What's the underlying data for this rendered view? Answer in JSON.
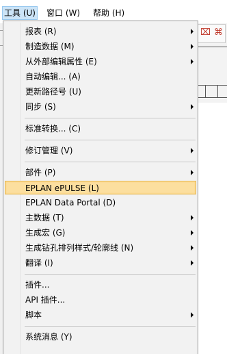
{
  "menubar": {
    "items": [
      {
        "label": "工具 (U)"
      },
      {
        "label": "窗口 (W)"
      },
      {
        "label": "帮助 (H)"
      }
    ]
  },
  "background": {
    "toolbar_glyphs": [
      "⌧",
      "⌘"
    ]
  },
  "menu": {
    "items": [
      {
        "label": "报表 (R)",
        "submenu": true
      },
      {
        "label": "制造数据 (M)",
        "submenu": true
      },
      {
        "label": "从外部编辑属性 (E)",
        "submenu": true
      },
      {
        "label": "自动编辑... (A)",
        "submenu": false
      },
      {
        "label": "更新路径号 (U)",
        "submenu": false
      },
      {
        "label": "同步 (S)",
        "submenu": true
      },
      {
        "label": "标准转换... (C)",
        "submenu": false
      },
      {
        "label": "修订管理 (V)",
        "submenu": true
      },
      {
        "label": "部件 (P)",
        "submenu": true
      },
      {
        "label": "EPLAN ePULSE (L)",
        "submenu": false,
        "highlighted": true
      },
      {
        "label": "EPLAN Data Portal (D)",
        "submenu": false
      },
      {
        "label": "主数据 (T)",
        "submenu": true
      },
      {
        "label": "生成宏 (G)",
        "submenu": true
      },
      {
        "label": "生成钻孔排列样式/轮廓线 (N)",
        "submenu": true
      },
      {
        "label": "翻译 (I)",
        "submenu": true
      },
      {
        "label": "插件...",
        "submenu": false
      },
      {
        "label": "API 插件...",
        "submenu": false
      },
      {
        "label": "脚本",
        "submenu": true
      },
      {
        "label": "系统消息 (Y)",
        "submenu": false
      }
    ]
  }
}
